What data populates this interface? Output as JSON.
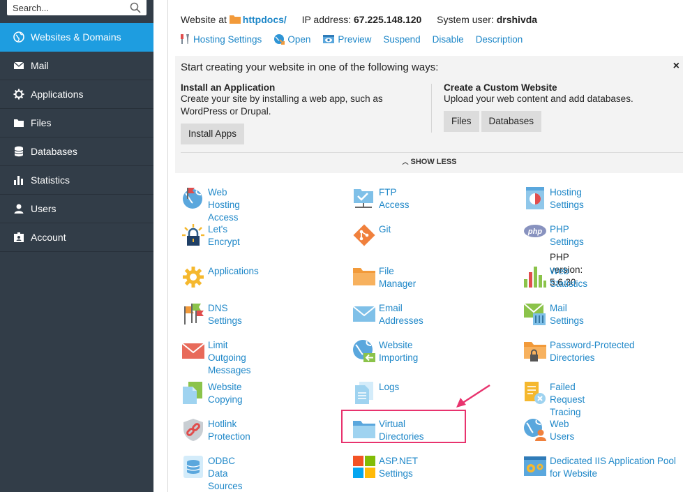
{
  "search": {
    "placeholder": "Search..."
  },
  "sidebar": {
    "items": [
      {
        "label": "Websites & Domains",
        "icon": "globe-icon",
        "active": true
      },
      {
        "label": "Mail",
        "icon": "envelope-icon"
      },
      {
        "label": "Applications",
        "icon": "gear-icon"
      },
      {
        "label": "Files",
        "icon": "folder-icon"
      },
      {
        "label": "Databases",
        "icon": "database-icon"
      },
      {
        "label": "Statistics",
        "icon": "bar-chart-icon"
      },
      {
        "label": "Users",
        "icon": "user-icon"
      },
      {
        "label": "Account",
        "icon": "account-card-icon"
      }
    ]
  },
  "site": {
    "website_label": "Website at",
    "docroot": "httpdocs/",
    "ip_label": "IP address:",
    "ip": "67.225.148.120",
    "user_label": "System user:",
    "user": "drshivda"
  },
  "actions": {
    "hosting_settings": "Hosting Settings",
    "open": "Open",
    "preview": "Preview",
    "suspend": "Suspend",
    "disable": "Disable",
    "description": "Description"
  },
  "panel": {
    "title": "Start creating your website in one of the following ways:",
    "close": "×",
    "install_title": "Install an Application",
    "install_text": "Create your site by installing a web app, such as WordPress or Drupal.",
    "install_button": "Install Apps",
    "custom_title": "Create a Custom Website",
    "custom_text": "Upload your web content and add databases.",
    "files_button": "Files",
    "databases_button": "Databases",
    "show_less": "SHOW LESS"
  },
  "tools": {
    "web_hosting_access": "Web Hosting Access",
    "ftp_access": "FTP Access",
    "hosting_settings": "Hosting Settings",
    "lets_encrypt": "Let's Encrypt",
    "git": "Git",
    "php_settings": "PHP Settings",
    "php_version": "PHP version: 5.6.30",
    "applications": "Applications",
    "file_manager": "File Manager",
    "web_statistics": "Web Statistics",
    "dns_settings": "DNS Settings",
    "email_addresses": "Email Addresses",
    "mail_settings": "Mail Settings",
    "limit_outgoing": "Limit Outgoing Messages",
    "website_importing": "Website Importing",
    "password_protected": "Password-Protected Directories",
    "website_copying": "Website Copying",
    "logs": "Logs",
    "failed_request": "Failed Request Tracing",
    "hotlink_protection": "Hotlink Protection",
    "virtual_directories": "Virtual Directories",
    "web_users": "Web Users",
    "odbc": "ODBC Data Sources",
    "aspnet": "ASP.NET Settings",
    "iis_pool": "Dedicated IIS Application Pool for Website"
  },
  "colors": {
    "sidebar_bg": "#323d48",
    "active_bg": "#1e9de0",
    "link": "#1e87c8",
    "highlight": "#e8336e"
  }
}
